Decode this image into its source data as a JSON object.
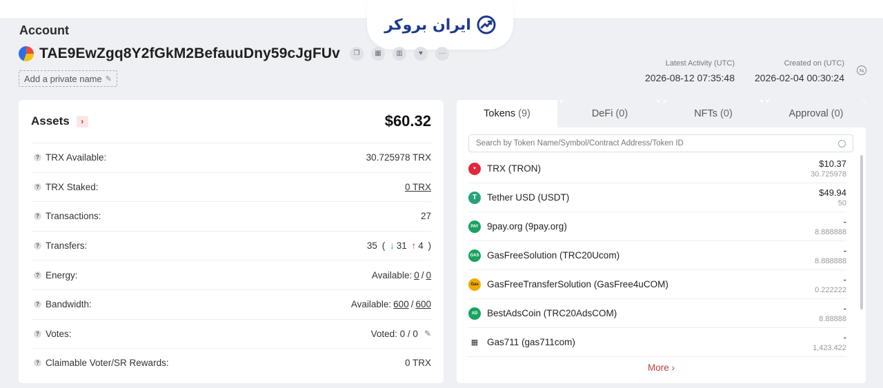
{
  "brand": {
    "logo_text": "ایران بروکر",
    "icon": "trend-arrow-icon"
  },
  "account": {
    "label": "Account",
    "address": "TAE9EwZgq8Y2fGkM2BefauuDny59cJgFUv",
    "private_name_label": "Add a private name",
    "latest_activity_label": "Latest Activity (UTC)",
    "latest_activity_value": "2026-08-12 07:35:48",
    "created_label": "Created on (UTC)",
    "created_value": "2026-02-04 00:30:24"
  },
  "assets": {
    "title": "Assets",
    "total": "$60.32",
    "rows": [
      {
        "label": "TRX Available:",
        "value": "30.725978 TRX"
      },
      {
        "label": "TRX Staked:",
        "value": "0 TRX"
      },
      {
        "label": "Transactions:",
        "value": "27"
      },
      {
        "label": "Transfers:",
        "total": "35",
        "down": "31",
        "up": "4"
      },
      {
        "label": "Energy:",
        "prefix": "Available:",
        "a": "0",
        "b": "0"
      },
      {
        "label": "Bandwidth:",
        "prefix": "Available:",
        "a": "600",
        "b": "600"
      },
      {
        "label": "Votes:",
        "value": "Voted: 0 / 0"
      },
      {
        "label": "Claimable Voter/SR Rewards:",
        "value": "0 TRX"
      }
    ]
  },
  "tabs": [
    {
      "label": "Tokens",
      "count": "(9)"
    },
    {
      "label": "DeFi",
      "count": "(0)"
    },
    {
      "label": "NFTs",
      "count": "(0)"
    },
    {
      "label": "Approval",
      "count": "(0)"
    }
  ],
  "search": {
    "placeholder": "Search by Token Name/Symbol/Contract Address/Token ID"
  },
  "tokens": [
    {
      "name": "TRX (TRON)",
      "usd": "$10.37",
      "amount": "30.725978",
      "icon_text": "",
      "color": "#e0283a"
    },
    {
      "name": "Tether USD (USDT)",
      "usd": "$49.94",
      "amount": "50",
      "icon_text": "T",
      "color": "#26a17b"
    },
    {
      "name": "9pay.org (9pay.org)",
      "usd": "-",
      "amount": "8.888888",
      "icon_text": "PAY",
      "color": "#1aa260"
    },
    {
      "name": "GasFreeSolution (TRC20Ucom)",
      "usd": "-",
      "amount": "8.888888",
      "icon_text": "GAS",
      "color": "#1aa260"
    },
    {
      "name": "GasFreeTransferSolution (GasFree4uCOM)",
      "usd": "-",
      "amount": "0.222222",
      "icon_text": "Gas",
      "color": "#f2a900"
    },
    {
      "name": "BestAdsCoin (TRC20AdsCOM)",
      "usd": "-",
      "amount": "8.88888",
      "icon_text": "AD",
      "color": "#1aa260"
    },
    {
      "name": "Gas711 (gas711com)",
      "usd": "-",
      "amount": "1,423.422",
      "icon_text": "",
      "color": "#333333"
    }
  ],
  "more_label": "More"
}
